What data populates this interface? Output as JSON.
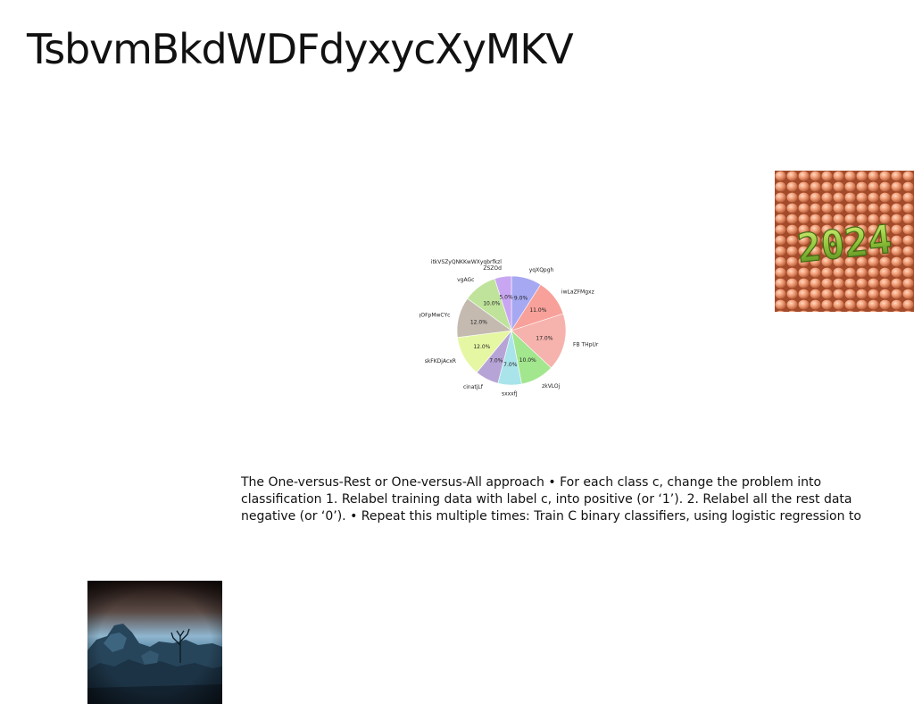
{
  "slide": {
    "title": "TsbvmBkdWDFdyxycXyMKV",
    "body_text": "The One-versus-Rest or One-versus-All approach • For each class c, change the problem into classification 1. Relabel training data with label c, into positive (or ‘1’). 2. Relabel all the rest data negative (or ‘0’). • Repeat this multiple times: Train C binary classifiers, using logistic regression to"
  },
  "images": {
    "top_right": {
      "overlay_text": "2024"
    }
  },
  "chart_data": {
    "type": "pie",
    "title": "",
    "categories": [
      "yqXQpgh",
      "iwLaZFMgxz",
      "FB THpUr",
      "zkVLOj",
      "sxxxfJ",
      "cinatjLf",
      "skFKDjAcxR",
      "egOFpMwCYc",
      "vgAGc",
      "itkVSZyQNKKwWXyqbrfkzl ZSZOd"
    ],
    "values": [
      9.0,
      11.0,
      17.0,
      10.0,
      7.0,
      7.0,
      12.0,
      12.0,
      10.0,
      5.0
    ],
    "value_labels": [
      "9.0%",
      "11.0%",
      "17.0%",
      "10.0%",
      "7.0%",
      "7.0%",
      "12.0%",
      "12.0%",
      "10.0%",
      "5.0%"
    ],
    "colors": [
      "#a6a8f2",
      "#f7a19a",
      "#f6b2ac",
      "#a2e68e",
      "#a9e4ea",
      "#b7a4d7",
      "#e6f7a3",
      "#c4bab0",
      "#bfe39b",
      "#c9a6f2"
    ]
  }
}
